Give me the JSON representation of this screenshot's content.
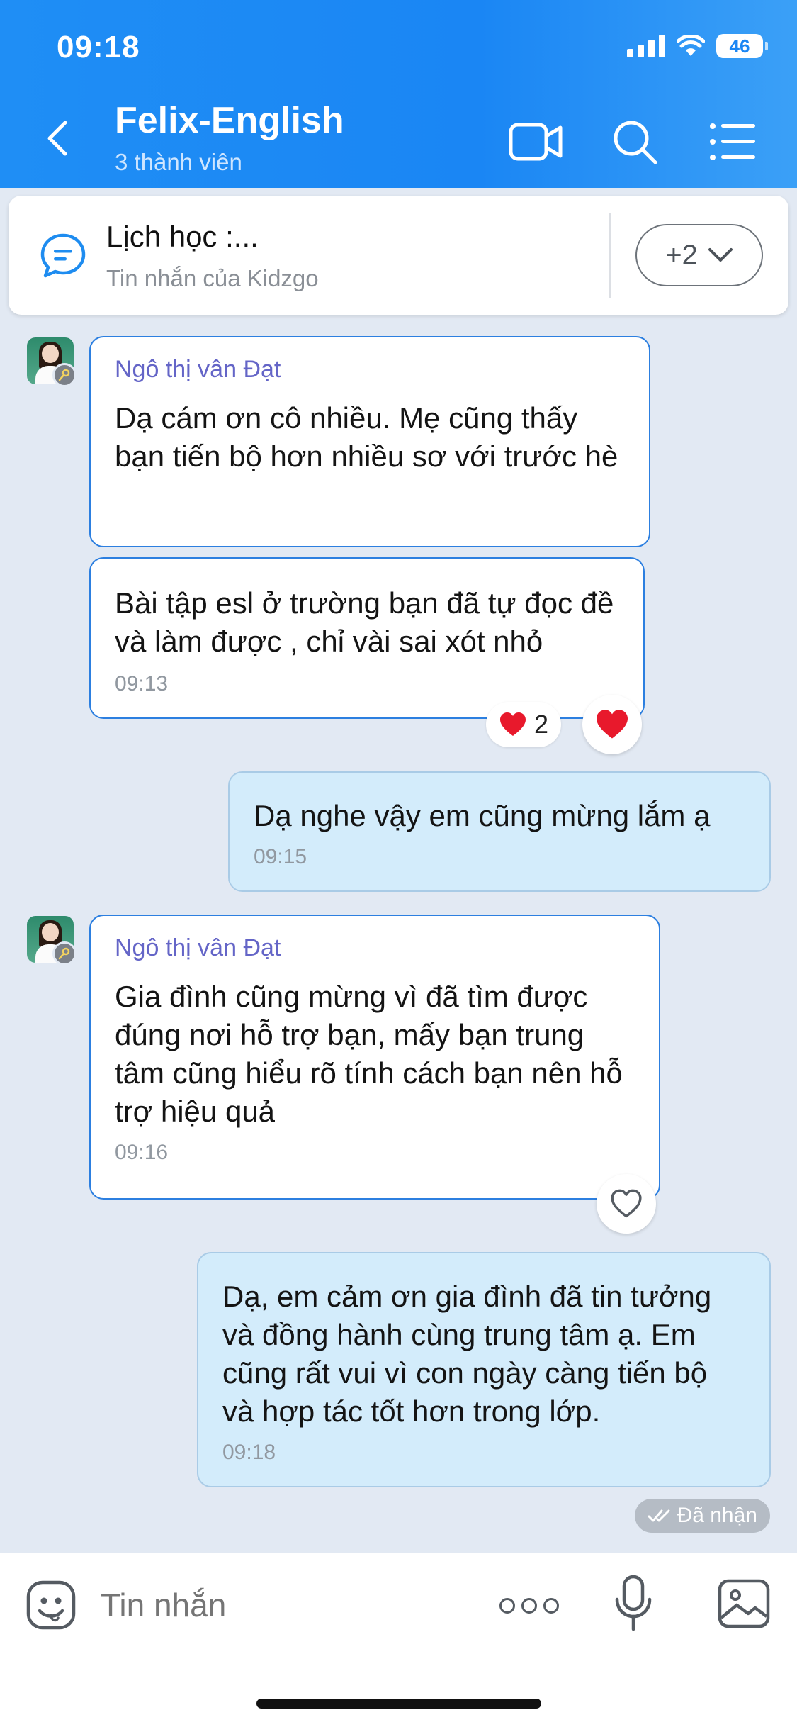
{
  "status_bar": {
    "time": "09:18",
    "battery": "46"
  },
  "header": {
    "title": "Felix-English",
    "subtitle": "3 thành viên",
    "icons": [
      "back-icon",
      "video-call-icon",
      "search-icon",
      "menu-list-icon"
    ]
  },
  "pinned": {
    "title": "Lịch học :...",
    "subtitle": "Tin nhắn của Kidzgo",
    "more_label": "+2"
  },
  "messages": [
    {
      "sender": "Ngô thị vân Đạt",
      "text": "Dạ cám ơn cô nhiều. Mẹ cũng thấy bạn tiến bộ hơn nhiều sơ với trước hè"
    },
    {
      "text": "Bài tập esl ở trường bạn đã tự đọc đề và làm được , chỉ vài sai xót nhỏ",
      "time": "09:13",
      "reaction_count": "2"
    },
    {
      "text": "Dạ nghe vậy em cũng mừng lắm ạ",
      "time": "09:15"
    },
    {
      "sender": "Ngô thị vân Đạt",
      "text": "Gia đình cũng mừng vì đã tìm được đúng nơi hỗ trợ bạn, mấy bạn trung tâm cũng hiểu rõ tính cách bạn nên hỗ trợ hiệu quả",
      "time": "09:16"
    },
    {
      "text": "Dạ, em cảm ơn gia đình đã tin tưởng và đồng hành cùng trung tâm ạ. Em cũng rất vui vì con ngày càng tiến bộ và hợp tác tốt hơn trong lớp.",
      "time": "09:18"
    }
  ],
  "delivery_status": "Đã nhận",
  "input": {
    "placeholder": "Tin nhắn"
  },
  "colors": {
    "header_blue": "#1a86f4",
    "incoming_border": "#2c7fe0",
    "outgoing_bg": "#d3ecfb",
    "sender_name": "#6465c7",
    "heart": "#e8192c"
  }
}
